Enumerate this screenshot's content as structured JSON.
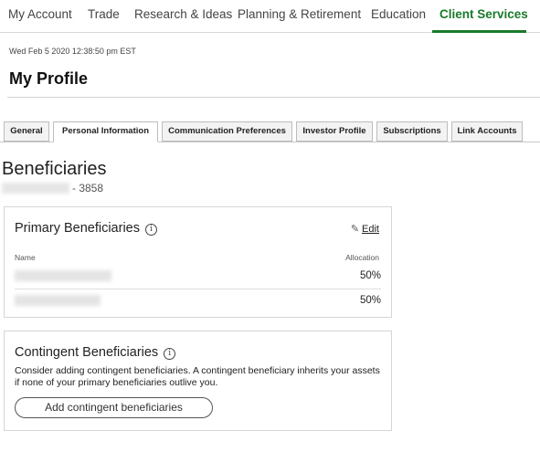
{
  "topnav": {
    "items": [
      {
        "label": "My Account"
      },
      {
        "label": "Trade"
      },
      {
        "label": "Research & Ideas"
      },
      {
        "label": "Planning & Retirement"
      },
      {
        "label": "Education"
      },
      {
        "label": "Client Services"
      }
    ],
    "active_item": "Client Services",
    "accent_color": "#1a7a2a"
  },
  "header": {
    "timestamp": "Wed Feb 5 2020 12:38:50 pm EST",
    "title": "My Profile"
  },
  "tabs": {
    "items": [
      {
        "label": "General"
      },
      {
        "label": "Personal Information"
      },
      {
        "label": "Communication Preferences"
      },
      {
        "label": "Investor Profile"
      },
      {
        "label": "Subscriptions"
      },
      {
        "label": "Link Accounts"
      }
    ],
    "active_tab": "Personal Information"
  },
  "beneficiaries": {
    "title": "Beneficiaries",
    "account_suffix": "- 3858",
    "primary": {
      "title": "Primary Beneficiaries",
      "info_icon": "info-icon",
      "edit_label": "Edit",
      "edit_icon": "pencil-icon",
      "columns": {
        "name": "Name",
        "allocation": "Allocation"
      },
      "rows": [
        {
          "allocation": "50%"
        },
        {
          "allocation": "50%"
        }
      ]
    },
    "contingent": {
      "title": "Contingent Beneficiaries",
      "info_icon": "info-icon",
      "description": "Consider adding contingent beneficiaries. A contingent beneficiary inherits your assets if none of your primary beneficiaries outlive you.",
      "add_button_label": "Add contingent beneficiaries"
    }
  }
}
